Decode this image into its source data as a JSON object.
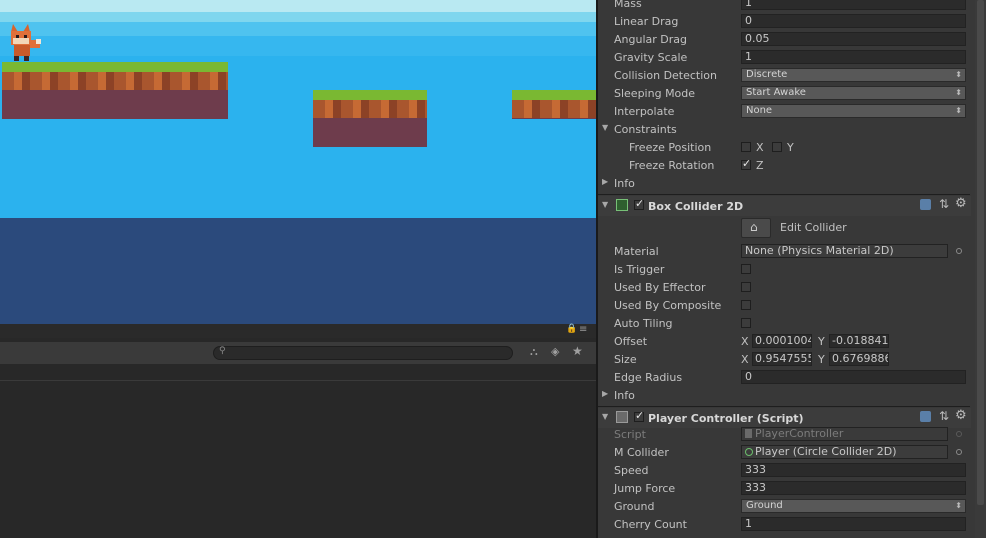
{
  "rigidbody": {
    "mass": {
      "label": "Mass",
      "value": "1"
    },
    "linear_drag": {
      "label": "Linear Drag",
      "value": "0"
    },
    "angular_drag": {
      "label": "Angular Drag",
      "value": "0.05"
    },
    "gravity_scale": {
      "label": "Gravity Scale",
      "value": "1"
    },
    "collision_detection": {
      "label": "Collision Detection",
      "value": "Discrete"
    },
    "sleeping_mode": {
      "label": "Sleeping Mode",
      "value": "Start Awake"
    },
    "interpolate": {
      "label": "Interpolate",
      "value": "None"
    },
    "constraints": {
      "label": "Constraints"
    },
    "freeze_position": {
      "label": "Freeze Position",
      "x_label": "X",
      "y_label": "Y",
      "x": false,
      "y": false
    },
    "freeze_rotation": {
      "label": "Freeze Rotation",
      "z_label": "Z",
      "z": true
    },
    "info_label": "Info"
  },
  "box_collider": {
    "title": "Box Collider 2D",
    "edit_collider_label": "Edit Collider",
    "material": {
      "label": "Material",
      "value": "None (Physics Material 2D)"
    },
    "is_trigger": {
      "label": "Is Trigger"
    },
    "used_by_effector": {
      "label": "Used By Effector"
    },
    "used_by_composite": {
      "label": "Used By Composite"
    },
    "auto_tiling": {
      "label": "Auto Tiling"
    },
    "offset": {
      "label": "Offset",
      "x_label": "X",
      "x": "0.0001004",
      "y_label": "Y",
      "y": "-0.018841"
    },
    "size": {
      "label": "Size",
      "x_label": "X",
      "x": "0.9547555",
      "y_label": "Y",
      "y": "0.6769886"
    },
    "edge_radius": {
      "label": "Edge Radius",
      "value": "0"
    },
    "info_label": "Info"
  },
  "player_controller": {
    "title": "Player Controller (Script)",
    "script": {
      "label": "Script",
      "value": "PlayerController"
    },
    "m_collider": {
      "label": "M Collider",
      "value": "Player (Circle Collider 2D)"
    },
    "speed": {
      "label": "Speed",
      "value": "333"
    },
    "jump_force": {
      "label": "Jump Force",
      "value": "333"
    },
    "ground": {
      "label": "Ground",
      "value": "Ground"
    },
    "cherry_count": {
      "label": "Cherry Count",
      "value": "1"
    }
  },
  "colors": {
    "sky": "#2bb2ee",
    "water": "#2b4a7c",
    "grass": "#7ab832",
    "dirt": "#6e3c4c",
    "panel": "#383838"
  }
}
